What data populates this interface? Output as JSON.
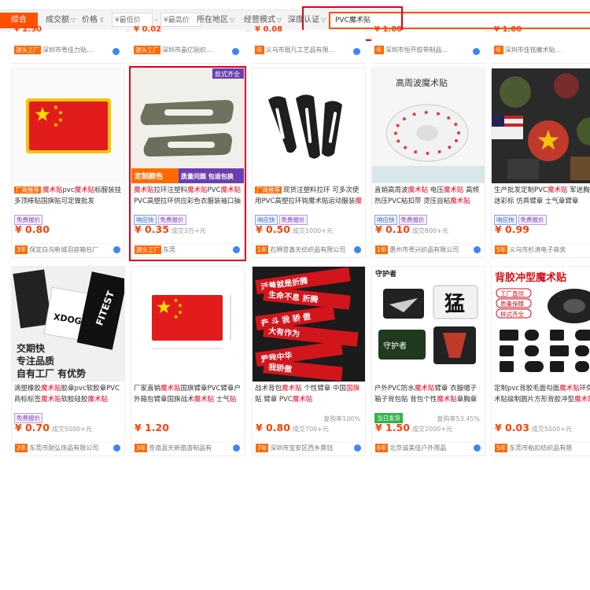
{
  "filter_bar": {
    "tabs": [
      {
        "label": "综合",
        "active": true
      },
      {
        "label": "成交额",
        "active": false
      },
      {
        "label": "价格",
        "active": false
      }
    ],
    "price_min_placeholder": "¥最低价",
    "price_max_placeholder": "¥最高价",
    "price_separator": "-",
    "dropdowns": [
      "所在地区",
      "经营模式",
      "深度认证"
    ],
    "search_value": "PVC魔术贴"
  },
  "top_strip": [
    {
      "price": "¥ 2.50",
      "shop": "深圳市粤佳力贴..."
    },
    {
      "price": "¥ 0.02",
      "shop": "深圳市晶亿贴织..."
    },
    {
      "price": "¥ 0.08",
      "shop": "义乌市珉凡工艺品有限..."
    },
    {
      "price": "¥ 1.00",
      "shop": "深圳市恒开胶带制品..."
    },
    {
      "price": "¥ 1.00",
      "shop": "深圳市佳铭魔术贴..."
    }
  ],
  "products": [
    {
      "id": "p1",
      "img_type": "flag",
      "title_parts": [
        {
          "t": "厂商推荐",
          "hl": "badge"
        },
        {
          "t": "魔术贴",
          "hl": "red"
        },
        {
          "t": "pvc",
          "hl": ""
        },
        {
          "t": "魔术贴",
          "hl": "red"
        },
        {
          "t": "标服装挂多顶棒贴国旗贴可定做批发",
          "hl": ""
        }
      ],
      "tags": [
        {
          "t": "免费报价",
          "c": "purple"
        }
      ],
      "price": "¥ 0.80",
      "sold": "",
      "rate": "",
      "years": "3年",
      "shop": "保定白沟新城羽容箱包厂"
    },
    {
      "id": "p2",
      "img_type": "strap",
      "title_parts": [
        {
          "t": "魔术贴",
          "hl": "red"
        },
        {
          "t": "拉环注塑料",
          "hl": ""
        },
        {
          "t": "魔术贴",
          "hl": "red"
        },
        {
          "t": "PVC",
          "hl": ""
        },
        {
          "t": "魔术贴",
          "hl": "red"
        },
        {
          "t": "PVC高塑拉环供应彩色衣服装袖口抽环现货",
          "hl": ""
        }
      ],
      "tags": [
        {
          "t": "响应快",
          "c": "blue"
        },
        {
          "t": "免费报价",
          "c": "purple"
        }
      ],
      "price": "¥ 0.35",
      "sold": "成交3万+元",
      "rate": "",
      "years": "源头工厂",
      "shop": "东莞"
    },
    {
      "id": "p3",
      "img_type": "blackstrap",
      "title_parts": [
        {
          "t": "厂商推荐",
          "hl": "badge"
        },
        {
          "t": "现货注塑料拉环 可多次使用PVC高塑拉环钩魔术贴运动服装",
          "hl": ""
        },
        {
          "t": "魔术贴",
          "hl": "red"
        }
      ],
      "tags": [
        {
          "t": "响应快",
          "c": "blue"
        },
        {
          "t": "免费报价",
          "c": "purple"
        }
      ],
      "price": "¥ 0.50",
      "sold": "成交1000+元",
      "rate": "",
      "years": "1年",
      "shop": "石狮誉鑫天纺织品有限公司"
    },
    {
      "id": "p4",
      "img_type": "roll",
      "title_parts": [
        {
          "t": "直销高周波",
          "hl": ""
        },
        {
          "t": "魔术贴",
          "hl": "red"
        },
        {
          "t": " 电压",
          "hl": ""
        },
        {
          "t": "魔术贴",
          "hl": "red"
        },
        {
          "t": " 高频热压PVC粘扣带 烫压自粘",
          "hl": ""
        },
        {
          "t": "魔术贴",
          "hl": "red"
        }
      ],
      "tags": [
        {
          "t": "响应快",
          "c": "blue"
        },
        {
          "t": "免费报价",
          "c": "purple"
        }
      ],
      "price": "¥ 0.10",
      "sold": "成交800+元",
      "rate": "",
      "years": "1年",
      "shop": "惠州市粤兴织品有限公司"
    },
    {
      "id": "p5",
      "img_type": "patches",
      "title_parts": [
        {
          "t": "生产批发定制PVC",
          "hl": ""
        },
        {
          "t": "魔术贴",
          "hl": "red"
        },
        {
          "t": " 军迷胸章 迷彩标 仿真臂章 士气章臂章",
          "hl": ""
        }
      ],
      "tags": [
        {
          "t": "响应快",
          "c": "blue"
        },
        {
          "t": "免费报价",
          "c": "purple"
        }
      ],
      "price": "¥ 0.99",
      "sold": "",
      "rate": "",
      "years": "5年",
      "shop": "义乌市杉涛电子商务"
    },
    {
      "id": "p6",
      "img_type": "labels",
      "title_parts": [
        {
          "t": "滴塑橡胶",
          "hl": ""
        },
        {
          "t": "魔术贴",
          "hl": "red"
        },
        {
          "t": "胶章pvc软胶章PVC商标标签",
          "hl": ""
        },
        {
          "t": "魔术贴",
          "hl": "red"
        },
        {
          "t": "软胶硅胶",
          "hl": ""
        },
        {
          "t": "魔术贴",
          "hl": "red"
        }
      ],
      "tags": [
        {
          "t": "免费报价",
          "c": "purple"
        }
      ],
      "price": "¥ 0.70",
      "sold": "成交5000+元",
      "rate": "",
      "years": "2年",
      "shop": "东莞市耐弘饰品有限公司"
    },
    {
      "id": "p7",
      "img_type": "flag2",
      "title_parts": [
        {
          "t": "厂家直销",
          "hl": ""
        },
        {
          "t": "魔术贴",
          "hl": "red"
        },
        {
          "t": "国旗臂章PVC臂章户外箱包臂章国旗战术",
          "hl": ""
        },
        {
          "t": "魔术贴",
          "hl": "red"
        },
        {
          "t": " 士气",
          "hl": ""
        },
        {
          "t": "贴",
          "hl": "red"
        }
      ],
      "tags": [],
      "price": "¥ 1.20",
      "sold": "",
      "rate": "",
      "years": "3年",
      "shop": "苍南县天新旅游制品有"
    },
    {
      "id": "p8",
      "img_type": "redpatch",
      "title_parts": [
        {
          "t": "战术背包",
          "hl": ""
        },
        {
          "t": "魔术贴",
          "hl": "red"
        },
        {
          "t": " 个性臂章 中国",
          "hl": ""
        },
        {
          "t": "国旗",
          "hl": "red"
        },
        {
          "t": "贴 臂章 PVC",
          "hl": ""
        },
        {
          "t": "魔术贴",
          "hl": "red"
        }
      ],
      "tags": [],
      "price": "¥ 0.80",
      "sold": "成交700+元",
      "rate": "复购率100%",
      "years": "7年",
      "shop": "深圳市宝安区西乡鼎钰"
    },
    {
      "id": "p9",
      "img_type": "armpatch",
      "title_parts": [
        {
          "t": "户外PVC防水",
          "hl": ""
        },
        {
          "t": "魔术贴",
          "hl": "red"
        },
        {
          "t": "臂章 衣服帽子箱子背包贴 背包个性",
          "hl": ""
        },
        {
          "t": "魔术贴",
          "hl": "red"
        },
        {
          "t": "章胸章",
          "hl": ""
        }
      ],
      "tags": [
        {
          "t": "当日发货",
          "c": "green"
        }
      ],
      "price": "¥ 1.50",
      "sold": "成交2000+元",
      "rate": "复购率53.45%",
      "years": "6年",
      "shop": "北京诚美佳户外用品"
    },
    {
      "id": "p10",
      "img_type": "blackglue",
      "title_parts": [
        {
          "t": "定制pvc背胶毛面勾面",
          "hl": ""
        },
        {
          "t": "魔术贴",
          "hl": "red"
        },
        {
          "t": "环保魔术贴级制圆片方形背胶冲型",
          "hl": ""
        },
        {
          "t": "魔术贴",
          "hl": "red"
        }
      ],
      "tags": [],
      "price": "¥ 0.03",
      "sold": "成交5000+元",
      "rate": "",
      "years": "5年",
      "shop": "东莞市粘扣纺织品有限"
    }
  ],
  "image_texts": {
    "p2_ribbon": "款式齐全",
    "p2_bottom_left": "定制颜色",
    "p2_bottom_right": "质量问题 包退包换",
    "p4_head": "高周波魔术贴",
    "p6_overlay": "交期快\n专注品质\n自有工厂 有优势",
    "p6_label1": "XDOG",
    "p6_label2": "FITEST",
    "p8_lines": [
      "活着就是折腾",
      "生命不息 折腾",
      "奋 斗 我 骄 傲",
      "大有作为",
      "爱我中华",
      "我骄傲"
    ],
    "p9_brand": "守护者",
    "p9_char": "猛",
    "p10_title": "背胶冲型魔术贴",
    "p10_side": [
      "工厂直供",
      "质量保障",
      "样式齐全"
    ]
  },
  "colors": {
    "accent": "#ff5000",
    "price": "#ff4000",
    "highlight": "#e0001b"
  }
}
